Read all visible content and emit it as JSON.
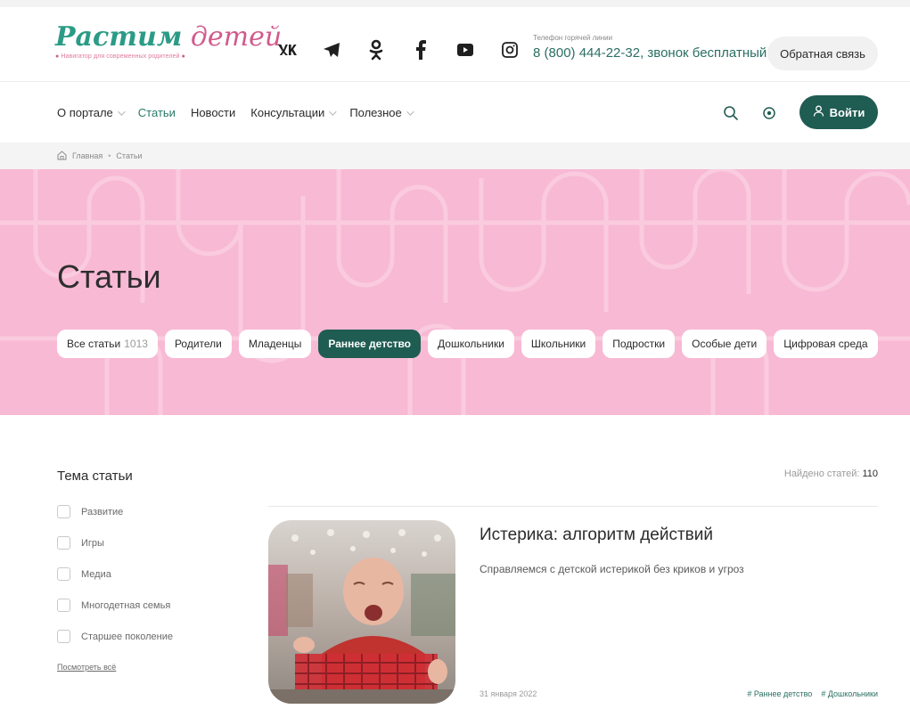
{
  "header": {
    "logo": {
      "word1": "Растим",
      "word2": "детей",
      "tagline": "Навигатор для современных родителей"
    },
    "socials": [
      {
        "icon": "vk-icon",
        "text": "vk"
      },
      {
        "icon": "telegram-icon",
        "text": ""
      },
      {
        "icon": "odnoklassniki-icon",
        "text": ""
      },
      {
        "icon": "facebook-icon",
        "text": "f"
      },
      {
        "icon": "youtube-icon",
        "text": ""
      },
      {
        "icon": "instagram-icon",
        "text": ""
      }
    ],
    "hotline_label": "Телефон горячей линии",
    "hotline_phone": "8 (800) 444-22-32, звонок бесплатный",
    "feedback_label": "Обратная связь"
  },
  "nav": {
    "items": [
      {
        "label": "О портале",
        "dropdown": true,
        "active": false
      },
      {
        "label": "Статьи",
        "dropdown": false,
        "active": true
      },
      {
        "label": "Новости",
        "dropdown": false,
        "active": false
      },
      {
        "label": "Консультации",
        "dropdown": true,
        "active": false
      },
      {
        "label": "Полезное",
        "dropdown": true,
        "active": false
      }
    ],
    "login_label": "Войти"
  },
  "breadcrumb": {
    "home": "Главная",
    "separator": "•",
    "current": "Статьи"
  },
  "hero": {
    "title": "Статьи",
    "filters": [
      {
        "label": "Все статьи",
        "count": "1013",
        "active": false
      },
      {
        "label": "Родители",
        "active": false
      },
      {
        "label": "Младенцы",
        "active": false
      },
      {
        "label": "Раннее детство",
        "active": true
      },
      {
        "label": "Дошкольники",
        "active": false
      },
      {
        "label": "Школьники",
        "active": false
      },
      {
        "label": "Подростки",
        "active": false
      },
      {
        "label": "Особые дети",
        "active": false
      },
      {
        "label": "Цифровая среда",
        "active": false
      }
    ]
  },
  "sidebar": {
    "title": "Тема статьи",
    "topics": [
      "Развитие",
      "Игры",
      "Медиа",
      "Многодетная семья",
      "Старшее поколение"
    ],
    "see_all": "Посмотреть всё"
  },
  "results": {
    "found_label": "Найдено статей:",
    "found_count": "110"
  },
  "article": {
    "title": "Истерика: алгоритм действий",
    "description": "Справляемся с детской истерикой без криков и угроз",
    "date": "31 января 2022",
    "tags": [
      "# Раннее детство",
      "# Дошкольники"
    ]
  },
  "colors": {
    "accent": "#1f5c52",
    "hero_pink": "#f8b9d4",
    "logo_green": "#2b9b86",
    "logo_pink": "#d15a8c"
  }
}
